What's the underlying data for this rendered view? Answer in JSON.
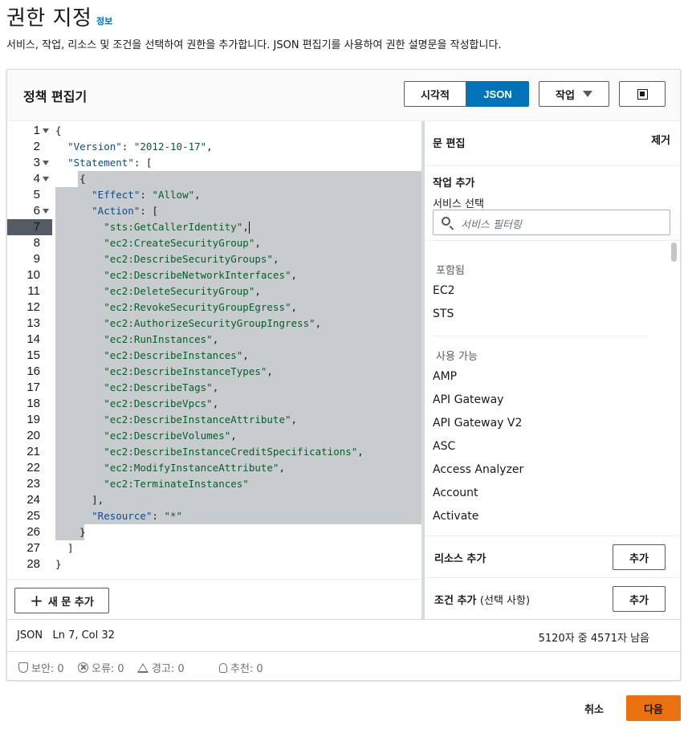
{
  "page": {
    "title": "권한 지정",
    "info_link": "정보",
    "description": "서비스, 작업, 리소스 및 조건을 선택하여 권한을 추가합니다. JSON 편집기를 사용하여 권한 설명문을 작성합니다."
  },
  "editor": {
    "title": "정책 편집기",
    "mode_visual": "시각적",
    "mode_json": "JSON",
    "selected_mode": "JSON",
    "action_menu": "작업",
    "add_statement": "새 문 추가",
    "code_lines": [
      "{",
      "  \"Version\": \"2012-10-17\",",
      "  \"Statement\": [",
      "    {",
      "      \"Effect\": \"Allow\",",
      "      \"Action\": [",
      "        \"sts:GetCallerIdentity\",",
      "        \"ec2:CreateSecurityGroup\",",
      "        \"ec2:DescribeSecurityGroups\",",
      "        \"ec2:DescribeNetworkInterfaces\",",
      "        \"ec2:DeleteSecurityGroup\",",
      "        \"ec2:RevokeSecurityGroupEgress\",",
      "        \"ec2:AuthorizeSecurityGroupIngress\",",
      "        \"ec2:RunInstances\",",
      "        \"ec2:DescribeInstances\",",
      "        \"ec2:DescribeInstanceTypes\",",
      "        \"ec2:DescribeTags\",",
      "        \"ec2:DescribeVpcs\",",
      "        \"ec2:DescribeInstanceAttribute\",",
      "        \"ec2:DescribeVolumes\",",
      "        \"ec2:DescribeInstanceCreditSpecifications\",",
      "        \"ec2:ModifyInstanceAttribute\",",
      "        \"ec2:TerminateInstances\"",
      "      ],",
      "      \"Resource\": \"*\"",
      "    }",
      "  ]",
      "}"
    ],
    "line_numbers": [
      "1",
      "2",
      "3",
      "4",
      "5",
      "6",
      "7",
      "8",
      "9",
      "10",
      "11",
      "12",
      "13",
      "14",
      "15",
      "16",
      "17",
      "18",
      "19",
      "20",
      "21",
      "22",
      "23",
      "24",
      "25",
      "26",
      "27",
      "28"
    ],
    "foldable_lines": [
      1,
      3,
      4,
      6
    ],
    "active_line": 7
  },
  "statement_panel": {
    "title": "문 편집",
    "remove": "제거",
    "add_action": "작업 추가",
    "service_label": "서비스 선택",
    "search_placeholder": "서비스 필터링",
    "included_header": "포함됨",
    "included": [
      "EC2",
      "STS"
    ],
    "available_header": "사용 가능",
    "available": [
      "AMP",
      "API Gateway",
      "API Gateway V2",
      "ASC",
      "Access Analyzer",
      "Account",
      "Activate"
    ],
    "add_resource_label": "리소스 추가",
    "add_resource_btn": "추가",
    "add_condition_label": "조건 추가",
    "add_condition_sub": "(선택 사항)",
    "add_condition_btn": "추가"
  },
  "status": {
    "mode": "JSON",
    "position": "Ln 7, Col 32",
    "char_count": "5120자 중 4571자 남음"
  },
  "issues": {
    "security": "보안: 0",
    "errors": "오류: 0",
    "warnings": "경고: 0",
    "suggestions": "추천: 0"
  },
  "footer": {
    "cancel": "취소",
    "next": "다음"
  },
  "colors": {
    "primary_blue": "#0073bb",
    "next_orange": "#ec7211",
    "selection_gray": "#c8cccf"
  }
}
